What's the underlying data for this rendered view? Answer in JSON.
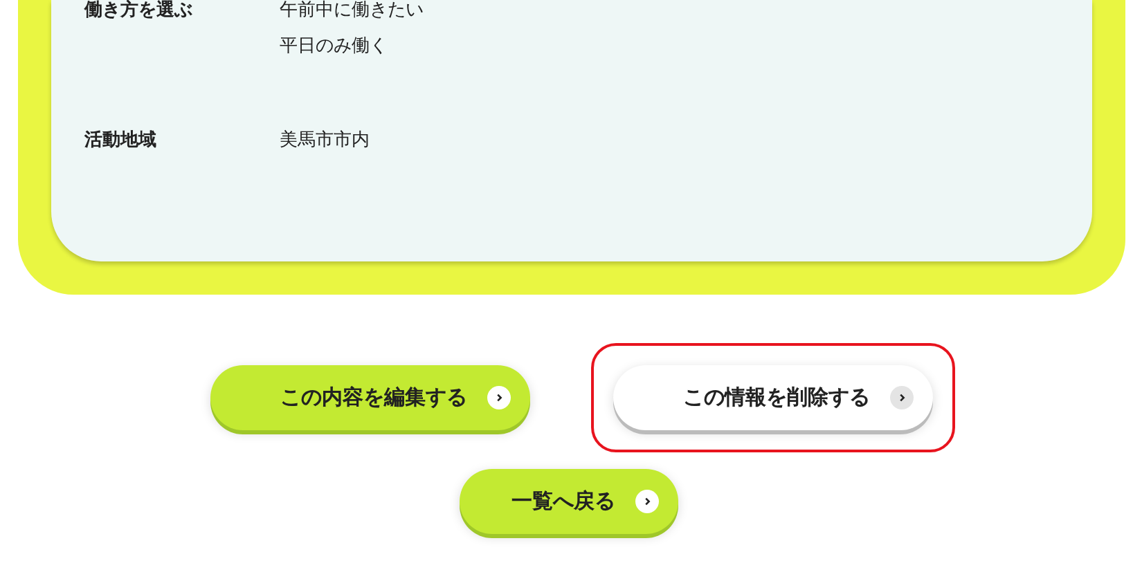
{
  "details": [
    {
      "label": "働き方を選ぶ",
      "values": [
        "午前中に働きたい",
        "平日のみ働く"
      ]
    },
    {
      "label": "活動地域",
      "values": [
        "美馬市市内"
      ]
    }
  ],
  "actions": [
    {
      "label": "この内容を編集する",
      "kind": "primary",
      "highlighted": false
    },
    {
      "label": "この情報を削除する",
      "kind": "secondary",
      "highlighted": true
    }
  ],
  "back": {
    "label": "一覧へ戻る",
    "kind": "primary",
    "highlighted": false
  }
}
